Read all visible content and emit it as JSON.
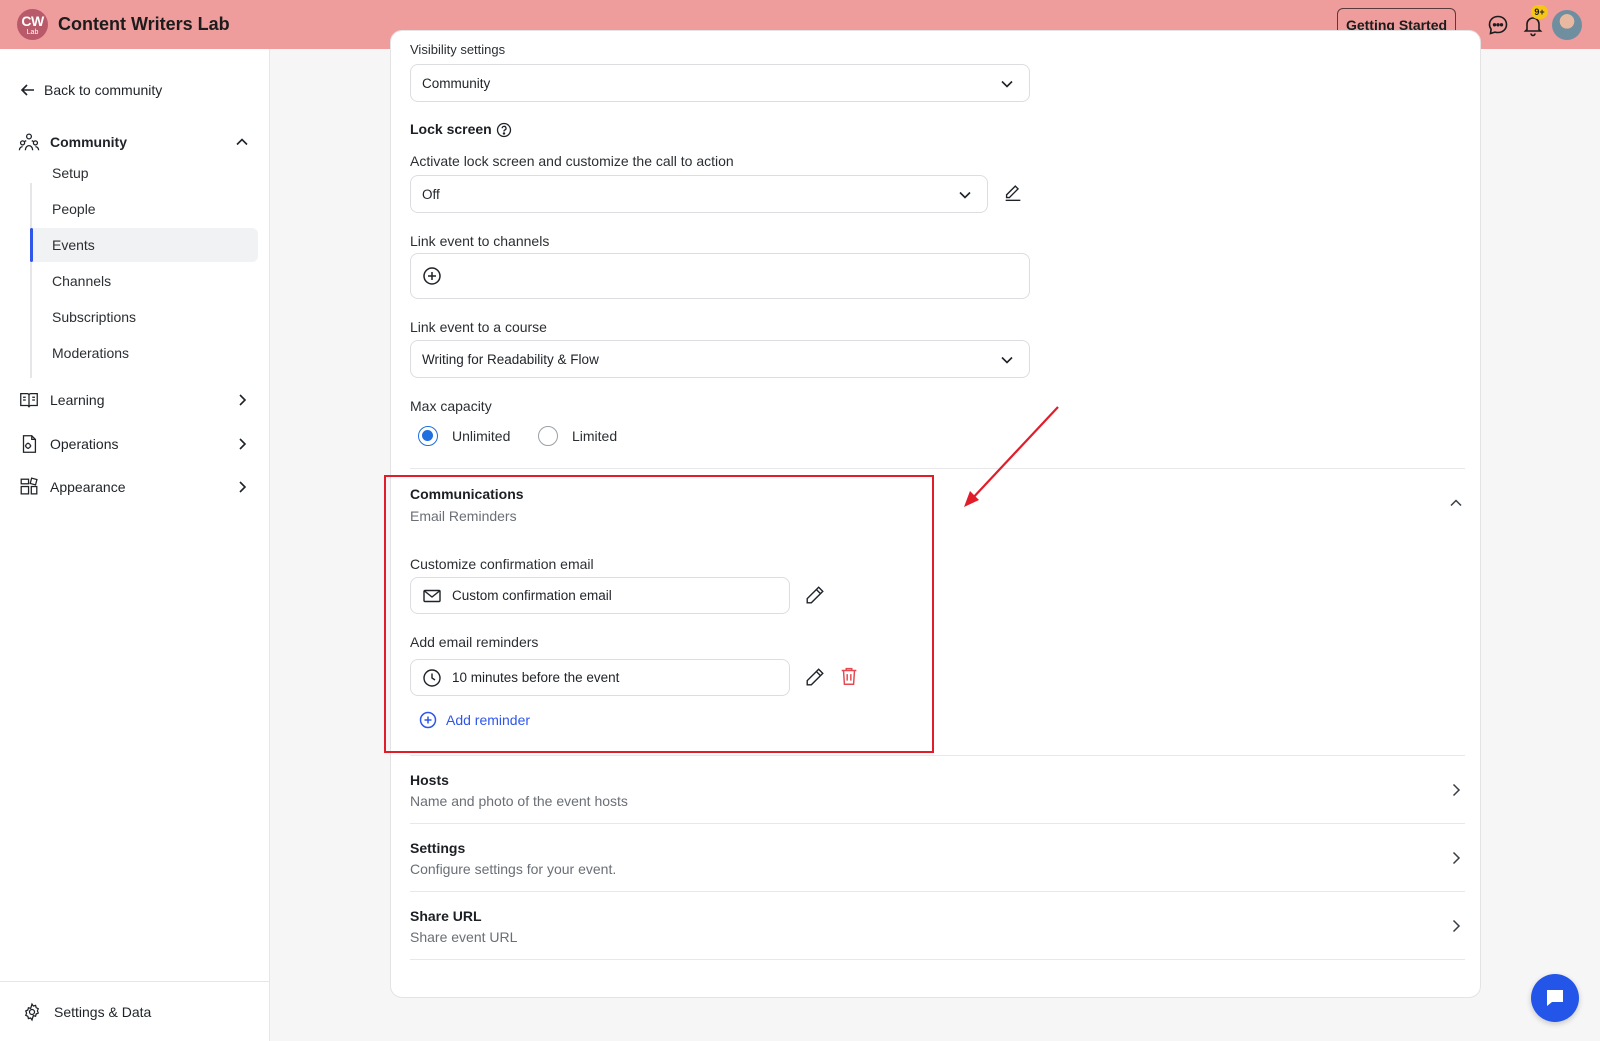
{
  "topbar": {
    "logo_main": "CW",
    "logo_sub": "Lab",
    "app_title": "Content Writers Lab",
    "getting_started": "Getting Started",
    "notif_badge": "9+"
  },
  "sidebar": {
    "back": "Back to community",
    "community": {
      "label": "Community",
      "items": [
        "Setup",
        "People",
        "Events",
        "Channels",
        "Subscriptions",
        "Moderations"
      ],
      "active": "Events"
    },
    "learning": "Learning",
    "operations": "Operations",
    "appearance": "Appearance",
    "footer": "Settings & Data"
  },
  "form": {
    "visibility_label": "Visibility settings",
    "visibility_value": "Community",
    "lock_label": "Lock screen",
    "lock_desc": "Activate lock screen and customize the call to action",
    "lock_value": "Off",
    "channels_label": "Link event to channels",
    "course_label": "Link event to a course",
    "course_value": "Writing for Readability & Flow",
    "capacity_label": "Max capacity",
    "capacity_options": [
      "Unlimited",
      "Limited"
    ],
    "capacity_selected": "Unlimited"
  },
  "communications": {
    "title": "Communications",
    "subtitle": "Email Reminders",
    "confirm_label": "Customize confirmation email",
    "confirm_value": "Custom confirmation email",
    "reminders_label": "Add email reminders",
    "reminder_value": "10 minutes before the event",
    "add_reminder": "Add reminder"
  },
  "sections": [
    {
      "title": "Hosts",
      "desc": "Name and photo of the event hosts"
    },
    {
      "title": "Settings",
      "desc": "Configure settings for your event."
    },
    {
      "title": "Share URL",
      "desc": "Share event URL"
    }
  ],
  "colors": {
    "topbar": "#ee9c9c",
    "accent": "#2f56e8",
    "highlight": "#e11d2a",
    "danger": "#e5484d"
  }
}
